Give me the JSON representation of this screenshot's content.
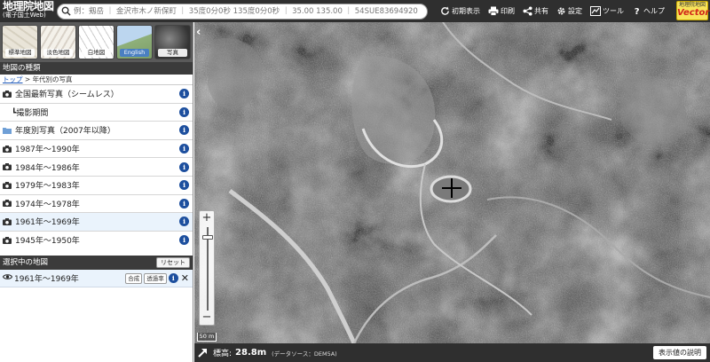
{
  "app": {
    "logo_main": "地理院地図",
    "logo_sub": "(電子国土Web)",
    "vector_badge_top": "地理院地図",
    "vector_badge_main": "Vector"
  },
  "search": {
    "placeholder": "例：剱岳 ｜ 金沢市木ノ新保町 ｜ 35度0分0秒 135度0分0秒 ｜ 35.00 135.00 ｜ 54SUE83694920"
  },
  "toolbar": {
    "reset_view": "初期表示",
    "print": "印刷",
    "share": "共有",
    "settings": "設定",
    "tools": "ツール",
    "help": "ヘルプ"
  },
  "basemaps": [
    {
      "label": "標準地図"
    },
    {
      "label": "淡色地図"
    },
    {
      "label": "白地図"
    },
    {
      "label": "English"
    },
    {
      "label": "写真"
    }
  ],
  "layers_panel": {
    "title": "地図の種類",
    "breadcrumb_link": "トップ",
    "breadcrumb_sep": " > ",
    "breadcrumb_current": "年代別の写真",
    "items": [
      {
        "label": "全国最新写真（シームレス）",
        "icon": "camera-icon"
      },
      {
        "label": "┗撮影期間",
        "icon": "none"
      },
      {
        "label": "年度別写真（2007年以降）",
        "icon": "folder-icon"
      },
      {
        "label": "1987年～1990年",
        "icon": "camera-icon"
      },
      {
        "label": "1984年～1986年",
        "icon": "camera-icon"
      },
      {
        "label": "1979年～1983年",
        "icon": "camera-icon"
      },
      {
        "label": "1974年～1978年",
        "icon": "camera-icon"
      },
      {
        "label": "1961年～1969年",
        "icon": "camera-icon"
      },
      {
        "label": "1945年～1950年",
        "icon": "camera-icon"
      }
    ]
  },
  "selected_panel": {
    "title": "選択中の地図",
    "reset_label": "リセット",
    "layer_label": "1961年～1969年",
    "composite_label": "合成",
    "opacity_label": "透過率"
  },
  "map": {
    "scale_label": "50 m"
  },
  "status": {
    "elevation_label": "標高:",
    "elevation_value": "28.8m",
    "source": "(データソース：DEM5A)",
    "explain_button": "表示値の説明"
  },
  "colors": {
    "bar": "#2f2f2f",
    "info": "#1d4f9e",
    "badge": "#f8e35a",
    "selected_row": "#eaf3fc"
  }
}
